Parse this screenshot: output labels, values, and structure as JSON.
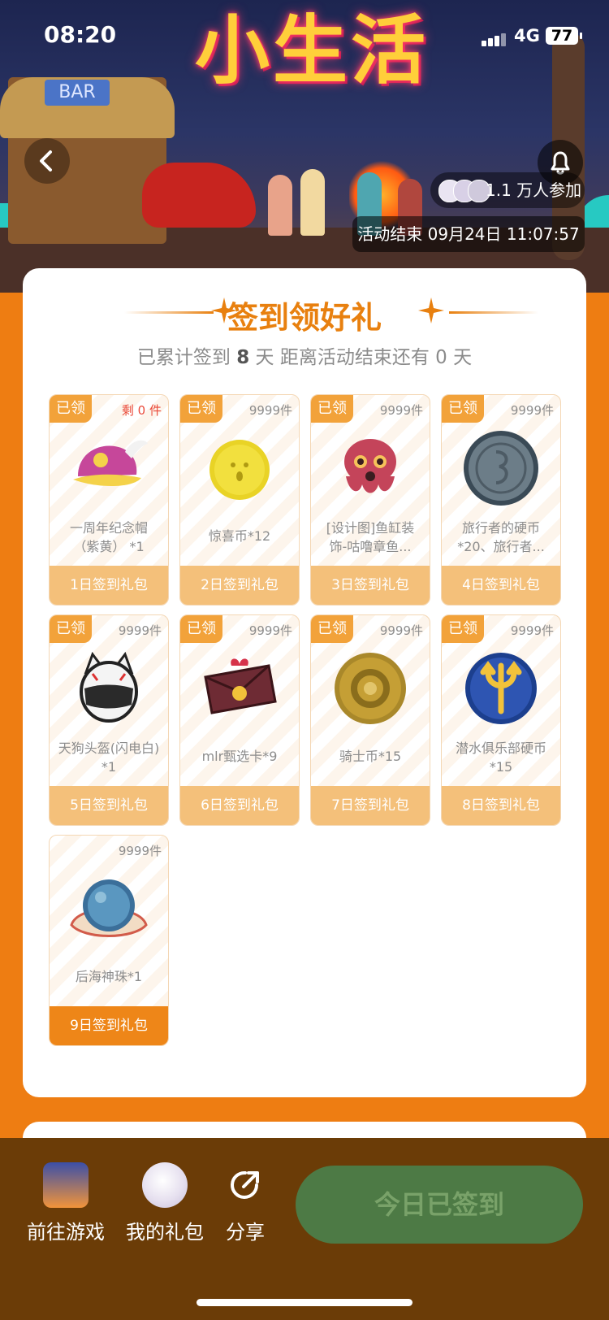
{
  "status_bar": {
    "time": "08:20",
    "network": "4G",
    "battery": "77"
  },
  "banner": {
    "title": "小生活",
    "bar_sign": "BAR",
    "participants": "1.1 万人参加",
    "end_time": "活动结束 09月24日 11:07:57"
  },
  "checkin": {
    "title": "签到领好礼",
    "summary_prefix": "已累计签到",
    "days_signed": "8",
    "summary_mid": "天  距离活动结束还有",
    "days_left": "0",
    "summary_suffix": "天",
    "claimed_label": "已领",
    "rewards": [
      {
        "name": "一周年纪念帽（紫黄） *1",
        "stock": "剩 0 件",
        "day": "1日签到礼包",
        "claimed": true
      },
      {
        "name": "惊喜币*12",
        "stock": "9999件",
        "day": "2日签到礼包",
        "claimed": true
      },
      {
        "name": "[设计图]鱼缸装饰-咕噜章鱼...",
        "stock": "9999件",
        "day": "3日签到礼包",
        "claimed": true
      },
      {
        "name": "旅行者的硬币*20、旅行者...",
        "stock": "9999件",
        "day": "4日签到礼包",
        "claimed": true
      },
      {
        "name": "天狗头盔(闪电白) *1",
        "stock": "9999件",
        "day": "5日签到礼包",
        "claimed": true
      },
      {
        "name": "mlr甄选卡*9",
        "stock": "9999件",
        "day": "6日签到礼包",
        "claimed": true
      },
      {
        "name": "骑士币*15",
        "stock": "9999件",
        "day": "7日签到礼包",
        "claimed": true
      },
      {
        "name": "潜水俱乐部硬币*15",
        "stock": "9999件",
        "day": "8日签到礼包",
        "claimed": true
      },
      {
        "name": "后海神珠*1",
        "stock": "9999件",
        "day": "9日签到礼包",
        "claimed": false
      }
    ]
  },
  "bottom_bar": {
    "goto_game": "前往游戏",
    "my_gifts": "我的礼包",
    "share": "分享",
    "checkin_button": "今日已签到"
  },
  "colors": {
    "accent": "#ee8618",
    "tile_footer": "#f4c07a",
    "page_bg": "#ee7d12",
    "bottom_bar": "#6b3c07",
    "checkin_button": "#4d7a45"
  }
}
